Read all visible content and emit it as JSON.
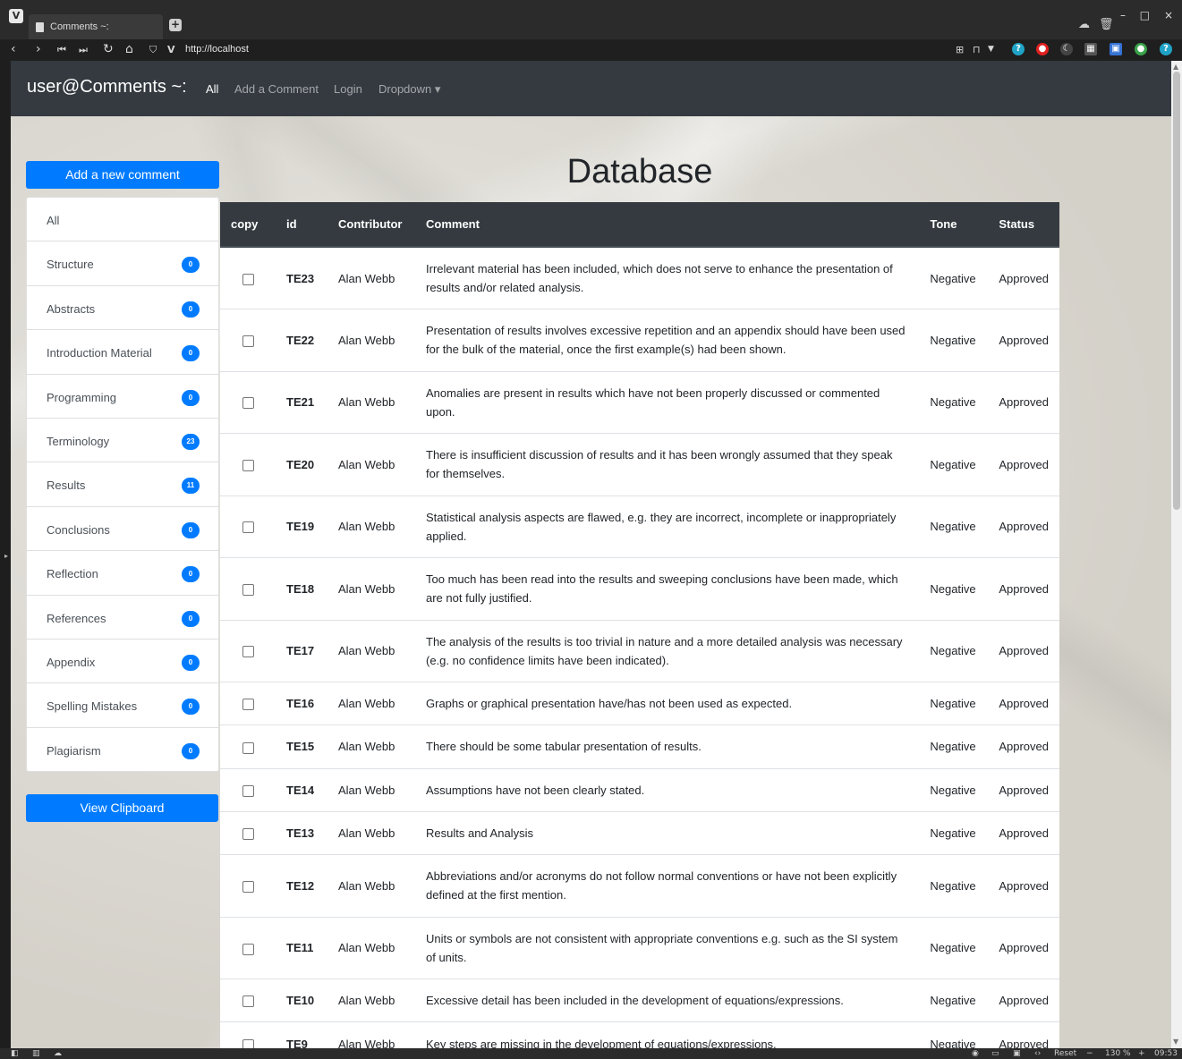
{
  "browser": {
    "tab_title": "Comments ~:",
    "url": "http://localhost",
    "zoom": "130 %",
    "reset_label": "Reset",
    "clock": "09:53"
  },
  "navbar": {
    "brand": "user@Comments ~:",
    "links": [
      "All",
      "Add a Comment",
      "Login",
      "Dropdown ▾"
    ]
  },
  "sidebar": {
    "add_button": "Add a new comment",
    "clipboard_button": "View Clipboard",
    "categories": [
      {
        "label": "All",
        "count": ""
      },
      {
        "label": "Structure",
        "count": "0"
      },
      {
        "label": "Abstracts",
        "count": "0"
      },
      {
        "label": "Introduction Material",
        "count": "0"
      },
      {
        "label": "Programming",
        "count": "0"
      },
      {
        "label": "Terminology",
        "count": "23"
      },
      {
        "label": "Results",
        "count": "11"
      },
      {
        "label": "Conclusions",
        "count": "0"
      },
      {
        "label": "Reflection",
        "count": "0"
      },
      {
        "label": "References",
        "count": "0"
      },
      {
        "label": "Appendix",
        "count": "0"
      },
      {
        "label": "Spelling Mistakes",
        "count": "0"
      },
      {
        "label": "Plagiarism",
        "count": "0"
      }
    ]
  },
  "main": {
    "title": "Database",
    "table": {
      "columns": [
        "copy",
        "id",
        "Contributor",
        "Comment",
        "Tone",
        "Status"
      ],
      "rows": [
        {
          "id": "TE23",
          "contributor": "Alan Webb",
          "comment": "Irrelevant material has been included, which does not serve to enhance the presentation of results and/or related analysis.",
          "tone": "Negative",
          "status": "Approved"
        },
        {
          "id": "TE22",
          "contributor": "Alan Webb",
          "comment": "Presentation of results involves excessive repetition and an appendix should have been used for the bulk of the material, once the first example(s) had been shown.",
          "tone": "Negative",
          "status": "Approved"
        },
        {
          "id": "TE21",
          "contributor": "Alan Webb",
          "comment": "Anomalies are present in results which have not been properly discussed or commented upon.",
          "tone": "Negative",
          "status": "Approved"
        },
        {
          "id": "TE20",
          "contributor": "Alan Webb",
          "comment": "There is insufficient discussion of results and it has been wrongly assumed that they speak for themselves.",
          "tone": "Negative",
          "status": "Approved"
        },
        {
          "id": "TE19",
          "contributor": "Alan Webb",
          "comment": "Statistical analysis aspects are flawed, e.g. they are incorrect, incomplete or inappropriately applied.",
          "tone": "Negative",
          "status": "Approved"
        },
        {
          "id": "TE18",
          "contributor": "Alan Webb",
          "comment": "Too much has been read into the results and sweeping conclusions have been made, which are not fully justified.",
          "tone": "Negative",
          "status": "Approved"
        },
        {
          "id": "TE17",
          "contributor": "Alan Webb",
          "comment": "The analysis of the results is too trivial in nature and a more detailed analysis was necessary (e.g. no confidence limits have been indicated).",
          "tone": "Negative",
          "status": "Approved"
        },
        {
          "id": "TE16",
          "contributor": "Alan Webb",
          "comment": "Graphs or graphical presentation have/has not been used as expected.",
          "tone": "Negative",
          "status": "Approved"
        },
        {
          "id": "TE15",
          "contributor": "Alan Webb",
          "comment": "There should be some tabular presentation of results.",
          "tone": "Negative",
          "status": "Approved"
        },
        {
          "id": "TE14",
          "contributor": "Alan Webb",
          "comment": "Assumptions have not been clearly stated.",
          "tone": "Negative",
          "status": "Approved"
        },
        {
          "id": "TE13",
          "contributor": "Alan Webb",
          "comment": "Results and Analysis",
          "tone": "Negative",
          "status": "Approved"
        },
        {
          "id": "TE12",
          "contributor": "Alan Webb",
          "comment": "Abbreviations and/or acronyms do not follow normal conventions or have not been explicitly defined at the first mention.",
          "tone": "Negative",
          "status": "Approved"
        },
        {
          "id": "TE11",
          "contributor": "Alan Webb",
          "comment": "Units or symbols are not consistent with appropriate conventions e.g. such as the SI system of units.",
          "tone": "Negative",
          "status": "Approved"
        },
        {
          "id": "TE10",
          "contributor": "Alan Webb",
          "comment": "Excessive detail has been included in the development of equations/expressions.",
          "tone": "Negative",
          "status": "Approved"
        },
        {
          "id": "TE9",
          "contributor": "Alan Webb",
          "comment": "Key steps are missing in the development of equations/expressions.",
          "tone": "Negative",
          "status": "Approved"
        }
      ]
    }
  },
  "colors": {
    "navbar": "#343a40",
    "primary": "#007bff",
    "table_header": "#343a40"
  }
}
